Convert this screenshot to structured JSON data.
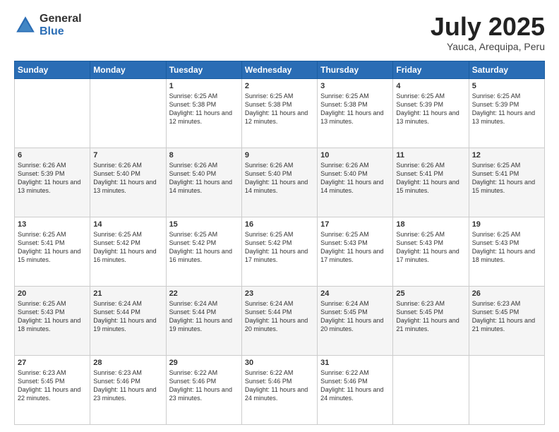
{
  "header": {
    "logo_general": "General",
    "logo_blue": "Blue",
    "title": "July 2025",
    "location": "Yauca, Arequipa, Peru"
  },
  "weekdays": [
    "Sunday",
    "Monday",
    "Tuesday",
    "Wednesday",
    "Thursday",
    "Friday",
    "Saturday"
  ],
  "weeks": [
    [
      {
        "day": "",
        "sunrise": "",
        "sunset": "",
        "daylight": ""
      },
      {
        "day": "",
        "sunrise": "",
        "sunset": "",
        "daylight": ""
      },
      {
        "day": "1",
        "sunrise": "Sunrise: 6:25 AM",
        "sunset": "Sunset: 5:38 PM",
        "daylight": "Daylight: 11 hours and 12 minutes."
      },
      {
        "day": "2",
        "sunrise": "Sunrise: 6:25 AM",
        "sunset": "Sunset: 5:38 PM",
        "daylight": "Daylight: 11 hours and 12 minutes."
      },
      {
        "day": "3",
        "sunrise": "Sunrise: 6:25 AM",
        "sunset": "Sunset: 5:38 PM",
        "daylight": "Daylight: 11 hours and 13 minutes."
      },
      {
        "day": "4",
        "sunrise": "Sunrise: 6:25 AM",
        "sunset": "Sunset: 5:39 PM",
        "daylight": "Daylight: 11 hours and 13 minutes."
      },
      {
        "day": "5",
        "sunrise": "Sunrise: 6:25 AM",
        "sunset": "Sunset: 5:39 PM",
        "daylight": "Daylight: 11 hours and 13 minutes."
      }
    ],
    [
      {
        "day": "6",
        "sunrise": "Sunrise: 6:26 AM",
        "sunset": "Sunset: 5:39 PM",
        "daylight": "Daylight: 11 hours and 13 minutes."
      },
      {
        "day": "7",
        "sunrise": "Sunrise: 6:26 AM",
        "sunset": "Sunset: 5:40 PM",
        "daylight": "Daylight: 11 hours and 13 minutes."
      },
      {
        "day": "8",
        "sunrise": "Sunrise: 6:26 AM",
        "sunset": "Sunset: 5:40 PM",
        "daylight": "Daylight: 11 hours and 14 minutes."
      },
      {
        "day": "9",
        "sunrise": "Sunrise: 6:26 AM",
        "sunset": "Sunset: 5:40 PM",
        "daylight": "Daylight: 11 hours and 14 minutes."
      },
      {
        "day": "10",
        "sunrise": "Sunrise: 6:26 AM",
        "sunset": "Sunset: 5:40 PM",
        "daylight": "Daylight: 11 hours and 14 minutes."
      },
      {
        "day": "11",
        "sunrise": "Sunrise: 6:26 AM",
        "sunset": "Sunset: 5:41 PM",
        "daylight": "Daylight: 11 hours and 15 minutes."
      },
      {
        "day": "12",
        "sunrise": "Sunrise: 6:25 AM",
        "sunset": "Sunset: 5:41 PM",
        "daylight": "Daylight: 11 hours and 15 minutes."
      }
    ],
    [
      {
        "day": "13",
        "sunrise": "Sunrise: 6:25 AM",
        "sunset": "Sunset: 5:41 PM",
        "daylight": "Daylight: 11 hours and 15 minutes."
      },
      {
        "day": "14",
        "sunrise": "Sunrise: 6:25 AM",
        "sunset": "Sunset: 5:42 PM",
        "daylight": "Daylight: 11 hours and 16 minutes."
      },
      {
        "day": "15",
        "sunrise": "Sunrise: 6:25 AM",
        "sunset": "Sunset: 5:42 PM",
        "daylight": "Daylight: 11 hours and 16 minutes."
      },
      {
        "day": "16",
        "sunrise": "Sunrise: 6:25 AM",
        "sunset": "Sunset: 5:42 PM",
        "daylight": "Daylight: 11 hours and 17 minutes."
      },
      {
        "day": "17",
        "sunrise": "Sunrise: 6:25 AM",
        "sunset": "Sunset: 5:43 PM",
        "daylight": "Daylight: 11 hours and 17 minutes."
      },
      {
        "day": "18",
        "sunrise": "Sunrise: 6:25 AM",
        "sunset": "Sunset: 5:43 PM",
        "daylight": "Daylight: 11 hours and 17 minutes."
      },
      {
        "day": "19",
        "sunrise": "Sunrise: 6:25 AM",
        "sunset": "Sunset: 5:43 PM",
        "daylight": "Daylight: 11 hours and 18 minutes."
      }
    ],
    [
      {
        "day": "20",
        "sunrise": "Sunrise: 6:25 AM",
        "sunset": "Sunset: 5:43 PM",
        "daylight": "Daylight: 11 hours and 18 minutes."
      },
      {
        "day": "21",
        "sunrise": "Sunrise: 6:24 AM",
        "sunset": "Sunset: 5:44 PM",
        "daylight": "Daylight: 11 hours and 19 minutes."
      },
      {
        "day": "22",
        "sunrise": "Sunrise: 6:24 AM",
        "sunset": "Sunset: 5:44 PM",
        "daylight": "Daylight: 11 hours and 19 minutes."
      },
      {
        "day": "23",
        "sunrise": "Sunrise: 6:24 AM",
        "sunset": "Sunset: 5:44 PM",
        "daylight": "Daylight: 11 hours and 20 minutes."
      },
      {
        "day": "24",
        "sunrise": "Sunrise: 6:24 AM",
        "sunset": "Sunset: 5:45 PM",
        "daylight": "Daylight: 11 hours and 20 minutes."
      },
      {
        "day": "25",
        "sunrise": "Sunrise: 6:23 AM",
        "sunset": "Sunset: 5:45 PM",
        "daylight": "Daylight: 11 hours and 21 minutes."
      },
      {
        "day": "26",
        "sunrise": "Sunrise: 6:23 AM",
        "sunset": "Sunset: 5:45 PM",
        "daylight": "Daylight: 11 hours and 21 minutes."
      }
    ],
    [
      {
        "day": "27",
        "sunrise": "Sunrise: 6:23 AM",
        "sunset": "Sunset: 5:45 PM",
        "daylight": "Daylight: 11 hours and 22 minutes."
      },
      {
        "day": "28",
        "sunrise": "Sunrise: 6:23 AM",
        "sunset": "Sunset: 5:46 PM",
        "daylight": "Daylight: 11 hours and 23 minutes."
      },
      {
        "day": "29",
        "sunrise": "Sunrise: 6:22 AM",
        "sunset": "Sunset: 5:46 PM",
        "daylight": "Daylight: 11 hours and 23 minutes."
      },
      {
        "day": "30",
        "sunrise": "Sunrise: 6:22 AM",
        "sunset": "Sunset: 5:46 PM",
        "daylight": "Daylight: 11 hours and 24 minutes."
      },
      {
        "day": "31",
        "sunrise": "Sunrise: 6:22 AM",
        "sunset": "Sunset: 5:46 PM",
        "daylight": "Daylight: 11 hours and 24 minutes."
      },
      {
        "day": "",
        "sunrise": "",
        "sunset": "",
        "daylight": ""
      },
      {
        "day": "",
        "sunrise": "",
        "sunset": "",
        "daylight": ""
      }
    ]
  ]
}
